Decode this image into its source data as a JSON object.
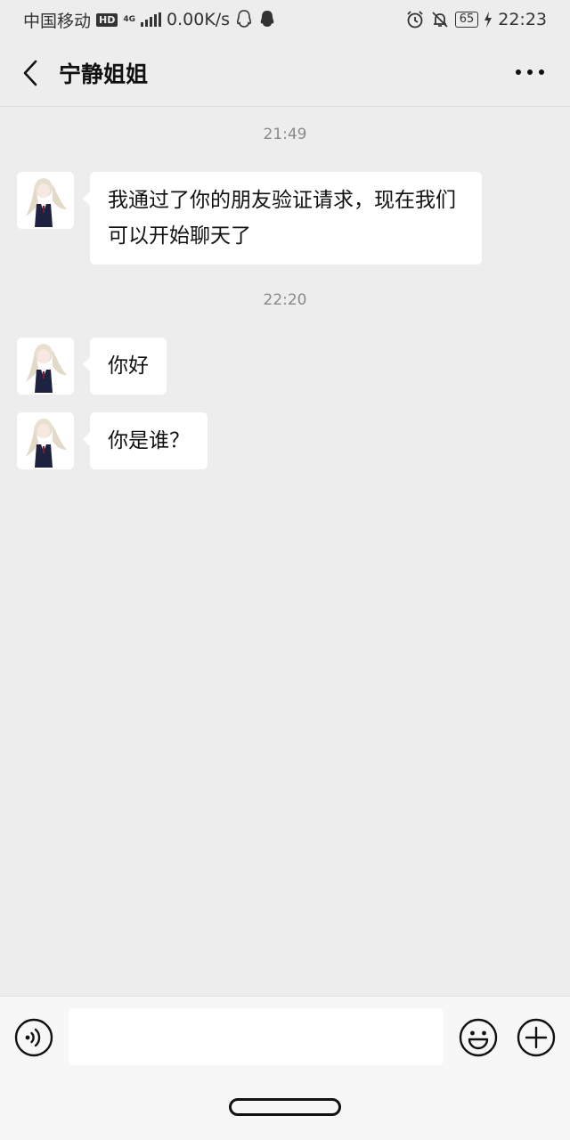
{
  "status_bar": {
    "carrier": "中国移动",
    "hd": "HD",
    "net": "4G",
    "speed": "0.00K/s",
    "battery": "65",
    "time": "22:23"
  },
  "header": {
    "title": "宁静姐姐"
  },
  "messages": [
    {
      "timestamp": "21:49",
      "text": "我通过了你的朋友验证请求，现在我们可以开始聊天了"
    },
    {
      "timestamp": "22:20",
      "text": "你好"
    },
    {
      "timestamp": "",
      "text": "你是谁？"
    }
  ],
  "input": {
    "value": "",
    "placeholder": ""
  },
  "icons": {
    "back": "back-arrow-icon",
    "more": "more-dots-icon",
    "voice": "voice-icon",
    "emoji": "emoji-icon",
    "add": "plus-icon"
  },
  "colors": {
    "background": "#ededed",
    "bubble": "#ffffff",
    "timestamp": "#8a8a8a"
  }
}
